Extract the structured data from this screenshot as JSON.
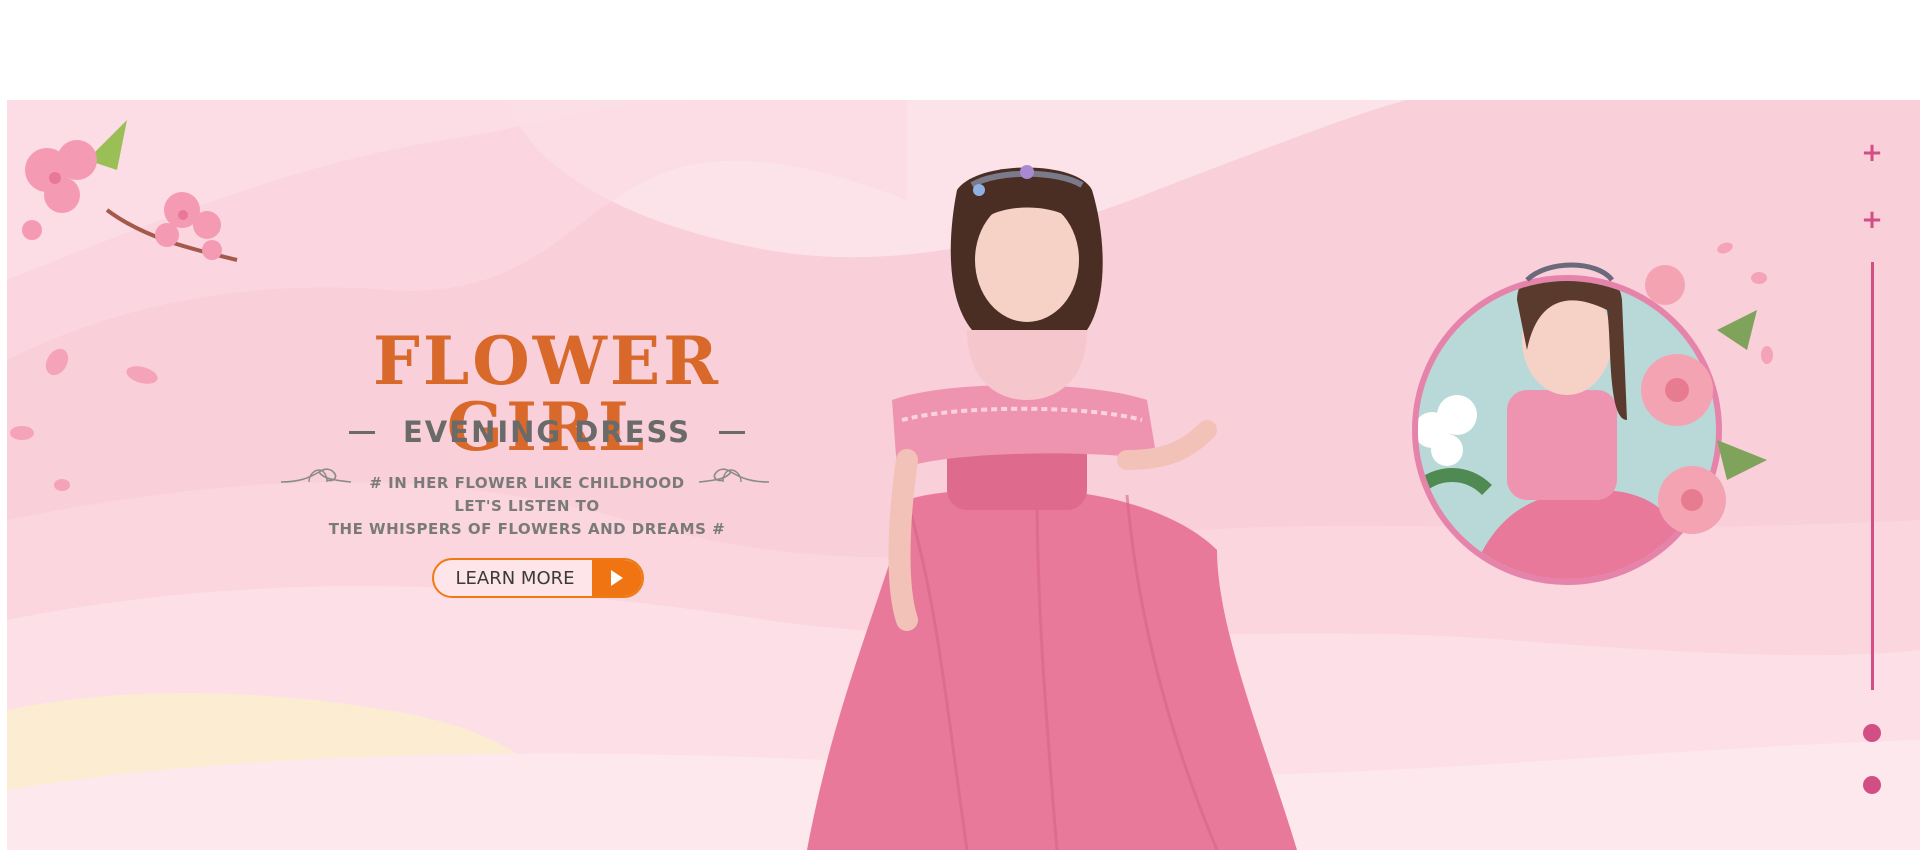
{
  "hero": {
    "title": "FLOWER GIRL",
    "subtitle": "EVENING DRESS",
    "tagline_line1": "#  IN HER FLOWER LIKE CHILDHOOD",
    "tagline_line2": "LET'S LISTEN TO",
    "tagline_line3": "THE WHISPERS OF FLOWERS AND DREAMS  #",
    "cta_label": "LEARN MORE"
  },
  "carousel": {
    "controls": [
      "plus-icon",
      "plus-icon"
    ],
    "indicator_count": 2
  },
  "colors": {
    "title": "#d9692b",
    "accent_orange": "#f07412",
    "rail_pink": "#d24f86",
    "banner_pink": "#f8c8d4"
  }
}
